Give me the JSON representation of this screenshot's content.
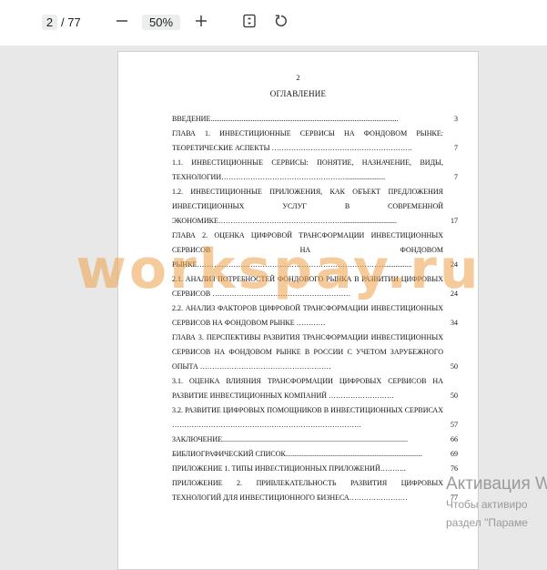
{
  "toolbar": {
    "current_page": "2",
    "total_pages": "/ 77",
    "zoom": "50%",
    "icons": [
      "minus-icon",
      "plus-icon",
      "fit-page-icon",
      "rotate-icon"
    ]
  },
  "document": {
    "page_number": "2",
    "title": "ОГЛАВЛЕНИЕ",
    "toc": [
      {
        "text": "ВВЕДЕНИЕ.......................................................................................................",
        "page": "3"
      },
      {
        "text": "ГЛАВА 1. ИНВЕСТИЦИОННЫЕ СЕРВИСЫ НА ФОНДОВОМ РЫНКЕ: ТЕОРЕТИЧЕСКИЕ АСПЕКТЫ ………………………………………………….",
        "page": "7"
      },
      {
        "text": "1.1. ИНВЕСТИЦИОННЫЕ СЕРВИСЫ: ПОНЯТИЕ, НАЗНАЧЕНИЕ, ВИДЫ, ТЕХНОЛОГИИ……………………………………………......................",
        "page": "7"
      },
      {
        "text": "1.2. ИНВЕСТИЦИОННЫЕ ПРИЛОЖЕНИЯ, КАК ОБЪЕКТ ПРЕДЛОЖЕНИЯ ИНВЕСТИЦИОННЫХ УСЛУГ В СОВРЕМЕННОЙ ЭКОНОМИКЕ……………………………………………..............................",
        "page": "17"
      },
      {
        "text": "ГЛАВА 2. ОЦЕНКА ЦИФРОВОЙ ТРАНСФОРМАЦИИ ИНВЕСТИЦИОННЫХ СЕРВИСОВ НА ФОНДОВОМ РЫНКЕ……………………………………………………………………..............",
        "page": "24"
      },
      {
        "text": "2.1. АНАЛИЗ ПОТРЕБНОСТЕЙ ФОНДОВОГО РЫНКА В РАЗВИТИИ ЦИФРОВЫХ СЕРВИСОВ …………………………………………………",
        "page": "24"
      },
      {
        "text": "2.2. АНАЛИЗ ФАКТОРОВ ЦИФРОВОЙ ТРАНСФОРМАЦИИ ИНВЕСТИЦИОННЫХ СЕРВИСОВ НА ФОНДОВОМ РЫНКЕ …………",
        "page": "34"
      },
      {
        "text": "ГЛАВА 3. ПЕРСПЕКТИВЫ РАЗВИТИЯ ТРАНСФОРМАЦИИ ИНВЕСТИЦИОННЫХ СЕРВИСОВ НА ФОНДОВОМ РЫНКЕ В РОССИИ С УЧЕТОМ ЗАРУБЕЖНОГО ОПЫТА ………………………………………………",
        "page": "50"
      },
      {
        "text": "3.1. ОЦЕНКА ВЛИЯНИЯ ТРАНСФОРМАЦИИ ЦИФРОВЫХ СЕРВИСОВ НА РАЗВИТИЕ ИНВЕСТИЦИОННЫХ КОМПАНИЙ ………………………",
        "page": "50"
      },
      {
        "text": "3.2. РАЗВИТИЕ ЦИФРОВЫХ ПОМОЩНИКОВ В ИНВЕСТИЦИОННЫХ СЕРВИСАХ ……………………………………………………………………",
        "page": "57"
      },
      {
        "text": "ЗАКЛЮЧЕНИЕ......................................................................................................",
        "page": "66"
      },
      {
        "text": "БИБЛИОГРАФИЧЕСКИЙ СПИСОК...........................................................................",
        "page": "69"
      },
      {
        "text": "ПРИЛОЖЕНИЕ 1. ТИПЫ ИНВЕСТИЦИОННЫХ ПРИЛОЖЕНИЙ………..",
        "page": "76"
      },
      {
        "text": "ПРИЛОЖЕНИЕ 2. ПРИВЛЕКАТЕЛЬНОСТЬ РАЗВИТИЯ ЦИФРОВЫХ ТЕХНОЛОГИЙ ДЛЯ ИНВЕСТИЦИОННОГО БИЗНЕСА……………………",
        "page": "77"
      }
    ]
  },
  "watermark": "workspay.ru",
  "activation": {
    "title": "Активация W",
    "line1": "Чтобы активиро",
    "line2": "раздел \"Параме"
  }
}
